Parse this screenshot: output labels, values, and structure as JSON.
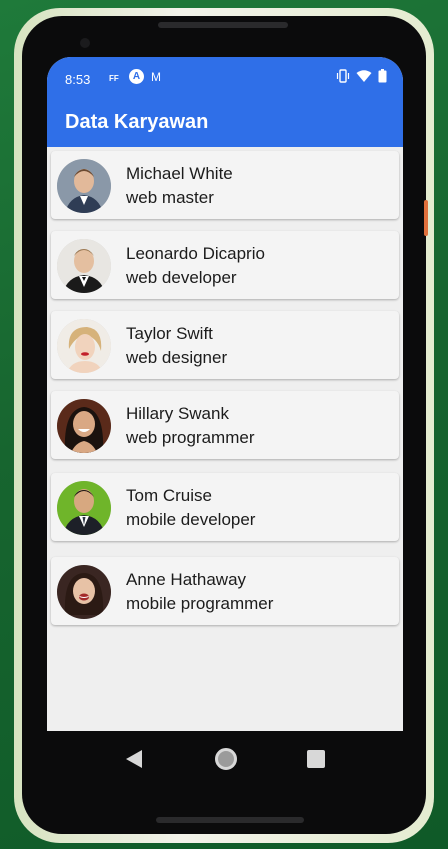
{
  "status_bar": {
    "time": "8:53",
    "notif_ff": "FF",
    "notif_a": "A",
    "notif_m": "M"
  },
  "app": {
    "title": "Data Karyawan",
    "accent_color": "#2f6fe8"
  },
  "employees": [
    {
      "name": "Michael White",
      "role": "web master",
      "avatar": "person-avatar"
    },
    {
      "name": "Leonardo Dicaprio",
      "role": "web developer",
      "avatar": "person-avatar"
    },
    {
      "name": "Taylor Swift",
      "role": "web designer",
      "avatar": "person-avatar"
    },
    {
      "name": "Hillary Swank",
      "role": "web programmer",
      "avatar": "person-avatar"
    },
    {
      "name": "Tom Cruise",
      "role": "mobile developer",
      "avatar": "person-avatar"
    },
    {
      "name": "Anne Hathaway",
      "role": "mobile programmer",
      "avatar": "person-avatar"
    }
  ],
  "nav_icons": [
    "back-icon",
    "home-icon",
    "recents-icon"
  ]
}
